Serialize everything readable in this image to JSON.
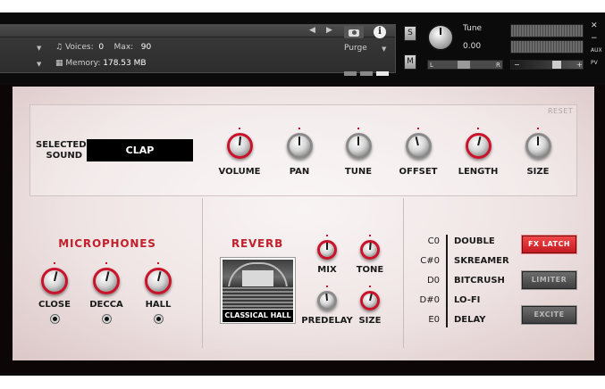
{
  "host": {
    "voices_label": "Voices:",
    "voices_value": "0",
    "max_label": "Max:",
    "max_value": "90",
    "memory_label": "Memory:",
    "memory_value": "178.53 MB",
    "purge_label": "Purge",
    "s_button": "S",
    "m_button": "M",
    "tune_label": "Tune",
    "tune_value": "0.00",
    "pan_left": "L",
    "pan_right": "R",
    "vol_minus": "−",
    "vol_plus": "+",
    "aux_label": "AUX",
    "pv_label": "PV",
    "info_glyph": "i"
  },
  "sound": {
    "selected_label": "SELECTED SOUND",
    "selected_value": "CLAP",
    "reset_label": "RESET",
    "knobs": [
      {
        "label": "VOLUME",
        "color": "red",
        "value": 0.52
      },
      {
        "label": "PAN",
        "color": "grey",
        "value": 0.5
      },
      {
        "label": "TUNE",
        "color": "grey",
        "value": 0.5
      },
      {
        "label": "OFFSET",
        "color": "grey",
        "value": 0.45
      },
      {
        "label": "LENGTH",
        "color": "red",
        "value": 0.55
      },
      {
        "label": "SIZE",
        "color": "grey",
        "value": 0.5
      }
    ]
  },
  "microphones": {
    "title": "MICROPHONES",
    "knobs": [
      {
        "label": "CLOSE",
        "value": 0.55
      },
      {
        "label": "DECCA",
        "value": 0.55
      },
      {
        "label": "HALL",
        "value": 0.55
      }
    ]
  },
  "reverb": {
    "title": "REVERB",
    "impulse_label": "CLASSICAL HALL",
    "knobs": [
      {
        "label": "MIX",
        "color": "red",
        "value": 0.5
      },
      {
        "label": "TONE",
        "color": "red",
        "value": 0.52
      },
      {
        "label": "PREDELAY",
        "color": "grey",
        "value": 0.48
      },
      {
        "label": "SIZE",
        "color": "red",
        "value": 0.55
      }
    ]
  },
  "fx": {
    "notes": [
      "C0",
      "C#0",
      "D0",
      "D#0",
      "E0"
    ],
    "names": [
      "DOUBLE",
      "SKREAMER",
      "BITCRUSH",
      "LO-FI",
      "DELAY"
    ],
    "buttons": [
      {
        "label": "FX LATCH",
        "state": "on"
      },
      {
        "label": "LIMITER",
        "state": "off"
      },
      {
        "label": "EXCITE",
        "state": "off"
      }
    ]
  },
  "colors": {
    "accent": "#c2202b",
    "knob_red": "#c9132b",
    "panel_bg": "#f3eaea"
  }
}
